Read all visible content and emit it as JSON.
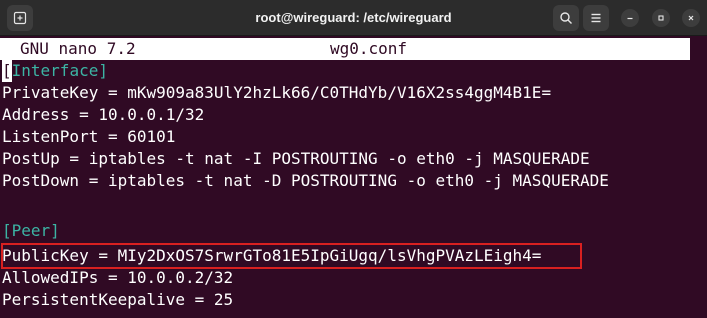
{
  "window": {
    "title": "root@wireguard: /etc/wireguard"
  },
  "nano": {
    "version": "GNU nano 7.2",
    "filename": "wg0.conf"
  },
  "lines": {
    "interface_bracket_open": "[",
    "interface_name": "Interface]",
    "private_key": "PrivateKey = mKw909a83UlY2hzLk66/C0THdYb/V16X2ss4ggM4B1E=",
    "address": "Address = 10.0.0.1/32",
    "listen_port": "ListenPort = 60101",
    "post_up": "PostUp = iptables -t nat -I POSTROUTING -o eth0 -j MASQUERADE",
    "post_down": "PostDown = iptables -t nat -D POSTROUTING -o eth0 -j MASQUERADE",
    "peer": "[Peer]",
    "public_key": "PublicKey = MIy2DxOS7SrwrGTo81E5IpGiUgq/lsVhgPVAzLEigh4=",
    "allowed_ips": "AllowedIPs = 10.0.0.2/32",
    "keepalive": "PersistentKeepalive = 25"
  },
  "colors": {
    "terminal_bg": "#300a24",
    "section_header": "#3cb4a4",
    "highlight_border": "#d92020"
  },
  "icons": {
    "new_tab": "new-tab-icon",
    "search": "search-icon",
    "menu": "hamburger-menu-icon",
    "minimize": "minimize-icon",
    "maximize": "maximize-icon",
    "close": "close-icon"
  }
}
